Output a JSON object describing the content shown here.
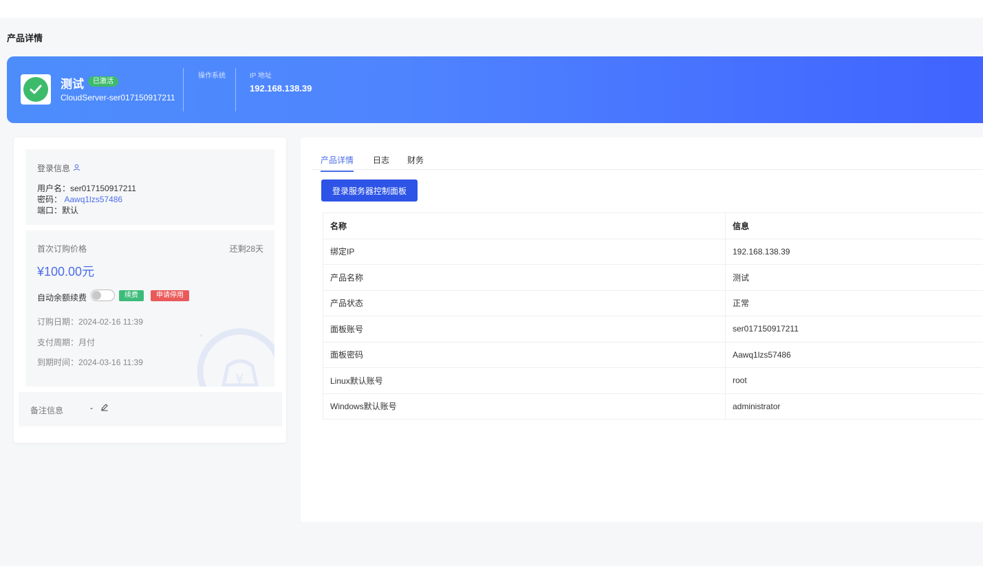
{
  "page_title": "产品详情",
  "banner": {
    "product_name": "测试",
    "status_badge": "已激活",
    "product_id": "CloudServer-ser017150917211",
    "os_label": "操作系统",
    "ip_label": "IP 地址",
    "ip_value": "192.168.138.39"
  },
  "login_info": {
    "title": "登录信息",
    "username_label": "用户名：",
    "username": "ser017150917211",
    "password_label": "密码：",
    "password": "Aawq1lzs57486",
    "port_label": "端口：",
    "port": "默认"
  },
  "pricing": {
    "first_price_label": "首次订购价格",
    "remaining": "还剩28天",
    "price": "¥100.00元",
    "auto_renew_label": "自动余额续费",
    "auto_renew_on": false,
    "renew_button": "续费",
    "stop_button": "申请停用",
    "order_date_label": "订购日期：",
    "order_date": "2024-02-16 11:39",
    "pay_cycle_label": "支付周期：",
    "pay_cycle": "月付",
    "expire_label": "到期时间：",
    "expire_date": "2024-03-16 11:39"
  },
  "note": {
    "label": "备注信息",
    "value": "-"
  },
  "tabs": [
    "产品详情",
    "日志",
    "财务"
  ],
  "login_panel_button": "登录服务器控制面板",
  "table": {
    "headers": [
      "名称",
      "信息"
    ],
    "rows": [
      [
        "绑定IP",
        "192.168.138.39"
      ],
      [
        "产品名称",
        "测试"
      ],
      [
        "产品状态",
        "正常"
      ],
      [
        "面板账号",
        "ser017150917211"
      ],
      [
        "面板密码",
        "Aawq1lzs57486"
      ],
      [
        "Linux默认账号",
        "root"
      ],
      [
        "Windows默认账号",
        "administrator"
      ]
    ]
  },
  "colors": {
    "accent": "#4b6ee8",
    "primary_button": "#2d54e6",
    "success": "#3dbb6b",
    "danger": "#ea5a5a"
  },
  "icons": {
    "status": "check-icon",
    "login_info": "user-icon",
    "note_edit": "edit-pencil-icon"
  }
}
